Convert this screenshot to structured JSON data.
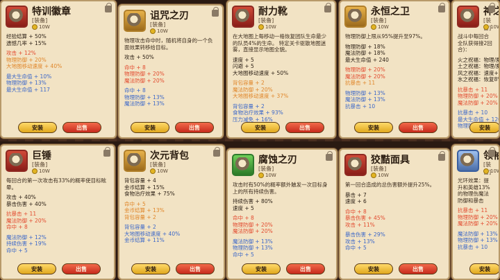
{
  "buttons": {
    "equip": "安装",
    "sell": "出售"
  },
  "cards": [
    {
      "name": "特训徽章",
      "tag": "[装备]",
      "price": "10W",
      "desc": "",
      "lines": [
        {
          "t": "经验结算 + 50%",
          "c": "dark"
        },
        {
          "t": "遗憾几率 + 15%",
          "c": "dark"
        },
        {
          "t": "",
          "c": "gap"
        },
        {
          "t": "攻击 + 12%",
          "c": "red"
        },
        {
          "t": "物理防御 + 20%",
          "c": "orange"
        },
        {
          "t": "大地图移动速度 + 40%",
          "c": "orange"
        },
        {
          "t": "",
          "c": "gap"
        },
        {
          "t": "最大生命值 + 10%",
          "c": "blue"
        },
        {
          "t": "物理防御 + 13%",
          "c": "blue"
        },
        {
          "t": "最大生命值 + 117",
          "c": "blue"
        }
      ]
    },
    {
      "name": "诅咒之刃",
      "tag": "[装备]",
      "price": "10W",
      "desc": "物理攻击命中时，随机将自身的一个负面效果转移给目标。",
      "lines": [
        {
          "t": "攻击 + 50%",
          "c": "dark"
        },
        {
          "t": "",
          "c": "gap"
        },
        {
          "t": "命中 + 8",
          "c": "red"
        },
        {
          "t": "物理防御 + 20%",
          "c": "red"
        },
        {
          "t": "魔法防御 + 20%",
          "c": "red"
        },
        {
          "t": "",
          "c": "gap"
        },
        {
          "t": "命中 + 8",
          "c": "blue"
        },
        {
          "t": "物理防御 + 13%",
          "c": "blue"
        },
        {
          "t": "魔法防御 + 13%",
          "c": "blue"
        }
      ]
    },
    {
      "name": "耐力靴",
      "tag": "[装备]",
      "price": "10W",
      "desc": "在大地图上每移动一格恢复团队生命最少的队员4%的生命。 特定关卡驱散地图迷雾，直接显示地图全貌。",
      "lines": [
        {
          "t": "速度 + 5",
          "c": "dark"
        },
        {
          "t": "闪避 + 5",
          "c": "dark"
        },
        {
          "t": "大地图移动速度 + 50%",
          "c": "dark"
        },
        {
          "t": "",
          "c": "gap"
        },
        {
          "t": "背包容量 + 2",
          "c": "orange"
        },
        {
          "t": "魔法防御 + 20%",
          "c": "orange"
        },
        {
          "t": "大地图移动速度 + 37%",
          "c": "orange"
        },
        {
          "t": "",
          "c": "gap"
        },
        {
          "t": "背包容量 + 2",
          "c": "blue"
        },
        {
          "t": "食物治疗效果 + 93%",
          "c": "blue"
        },
        {
          "t": "压力减免 + 16%",
          "c": "blue"
        }
      ]
    },
    {
      "name": "永恒之卫",
      "tag": "[装备]",
      "price": "10W",
      "desc": "物理防御上限从95%提升至97%。",
      "lines": [
        {
          "t": "物理防御 + 18%",
          "c": "dark"
        },
        {
          "t": "魔法防御 + 18%",
          "c": "dark"
        },
        {
          "t": "最大生命值 + 240",
          "c": "dark"
        },
        {
          "t": "",
          "c": "gap"
        },
        {
          "t": "物理防御 + 20%",
          "c": "red"
        },
        {
          "t": "魔法防御 + 20%",
          "c": "red"
        },
        {
          "t": "抗暴击 + 11",
          "c": "orange"
        },
        {
          "t": "",
          "c": "gap"
        },
        {
          "t": "物理防御 + 13%",
          "c": "blue"
        },
        {
          "t": "魔法防御 + 13%",
          "c": "blue"
        },
        {
          "t": "抗暴击 + 10",
          "c": "blue"
        }
      ]
    },
    {
      "name": "神之",
      "tag": "[装备]",
      "price": "10W",
      "desc": "战斗中每回合全队获得接2回合)：",
      "lines": [
        {
          "t": "火之祝福：物理/魔",
          "c": "dark"
        },
        {
          "t": "土之祝福：物理/魔",
          "c": "dark"
        },
        {
          "t": "风之祝福：速度+",
          "c": "dark"
        },
        {
          "t": "水之祝福：恢复8%",
          "c": "dark"
        },
        {
          "t": "",
          "c": "gap"
        },
        {
          "t": "抗暴击 + 11",
          "c": "red"
        },
        {
          "t": "物理防御 + 20%",
          "c": "red"
        },
        {
          "t": "魔法防御 + 20%",
          "c": "red"
        },
        {
          "t": "",
          "c": "gap"
        },
        {
          "t": "抗暴击 + 10",
          "c": "blue"
        },
        {
          "t": "最大生命值 + 120",
          "c": "blue"
        },
        {
          "t": "物理防御 + 13%",
          "c": "blue"
        }
      ]
    },
    {
      "name": "巨锤",
      "tag": "[装备]",
      "price": "10W",
      "desc": "每回合的第一次攻击有33%的概率使目标眩晕。",
      "lines": [
        {
          "t": "攻击 + 40%",
          "c": "dark"
        },
        {
          "t": "暴击伤害 + 40%",
          "c": "dark"
        },
        {
          "t": "",
          "c": "gap"
        },
        {
          "t": "抗暴击 + 11",
          "c": "red"
        },
        {
          "t": "魔法防御 + 20%",
          "c": "red"
        },
        {
          "t": "命中 + 8",
          "c": "red"
        },
        {
          "t": "",
          "c": "gap"
        },
        {
          "t": "魔法防御 + 12%",
          "c": "blue"
        },
        {
          "t": "持续伤害 + 19%",
          "c": "blue"
        },
        {
          "t": "命中 + 5",
          "c": "blue"
        }
      ]
    },
    {
      "name": "次元背包",
      "tag": "[装备]",
      "price": "10W",
      "desc": "",
      "lines": [
        {
          "t": "背包容量 + 4",
          "c": "dark"
        },
        {
          "t": "金币结算 + 15%",
          "c": "dark"
        },
        {
          "t": "食物治疗效果 + 75%",
          "c": "dark"
        },
        {
          "t": "",
          "c": "gap"
        },
        {
          "t": "命中 + 5",
          "c": "orange"
        },
        {
          "t": "金币结算 + 13%",
          "c": "orange"
        },
        {
          "t": "背包容量 + 2",
          "c": "orange"
        },
        {
          "t": "",
          "c": "gap"
        },
        {
          "t": "背包容量 + 2",
          "c": "blue"
        },
        {
          "t": "大地图移动速度 + 40%",
          "c": "blue"
        },
        {
          "t": "金币结算 + 11%",
          "c": "blue"
        }
      ]
    },
    {
      "name": "腐蚀之刃",
      "tag": "[装备]",
      "price": "10W",
      "desc": "攻击时有50%的概率额外触发一次目标身上的所有持续伤害。",
      "lines": [
        {
          "t": "持续伤害 + 80%",
          "c": "dark"
        },
        {
          "t": "速度 + 5",
          "c": "dark"
        },
        {
          "t": "",
          "c": "gap"
        },
        {
          "t": "命中 + 8",
          "c": "red"
        },
        {
          "t": "物理防御 + 20%",
          "c": "red"
        },
        {
          "t": "魔法防御 + 20%",
          "c": "red"
        },
        {
          "t": "",
          "c": "gap"
        },
        {
          "t": "魔法防御 + 13%",
          "c": "blue"
        },
        {
          "t": "物理防御 + 13%",
          "c": "blue"
        },
        {
          "t": "命中 + 5",
          "c": "blue"
        }
      ]
    },
    {
      "name": "狡黠面具",
      "tag": "[装备]",
      "price": "10W",
      "desc": "第一回合造成的总伤害额外提升25%。",
      "lines": [
        {
          "t": "暴击 + 7",
          "c": "dark"
        },
        {
          "t": "速度 + 6",
          "c": "dark"
        },
        {
          "t": "",
          "c": "gap"
        },
        {
          "t": "命中 + 8",
          "c": "red"
        },
        {
          "t": "暴击伤害 + 45%",
          "c": "red"
        },
        {
          "t": "攻击 + 11%",
          "c": "red"
        },
        {
          "t": "",
          "c": "gap"
        },
        {
          "t": "暴击伤害 + 29%",
          "c": "blue"
        },
        {
          "t": "攻击 + 13%",
          "c": "blue"
        },
        {
          "t": "命中 + 5",
          "c": "blue"
        }
      ]
    },
    {
      "name": "领袖",
      "tag": "[装备]",
      "price": "10W",
      "desc": "光环效果：提升和英雄13%的物理伤魔法防御和暴击",
      "lines": [
        {
          "t": "抗暴击 + 11",
          "c": "red"
        },
        {
          "t": "物理防御 + 20%",
          "c": "red"
        },
        {
          "t": "魔法防御 + 20%",
          "c": "red"
        },
        {
          "t": "",
          "c": "gap"
        },
        {
          "t": "魔法防御 + 13%",
          "c": "blue"
        },
        {
          "t": "物理防御 + 13%",
          "c": "blue"
        },
        {
          "t": "抗暴击 + 10",
          "c": "blue"
        }
      ]
    }
  ]
}
